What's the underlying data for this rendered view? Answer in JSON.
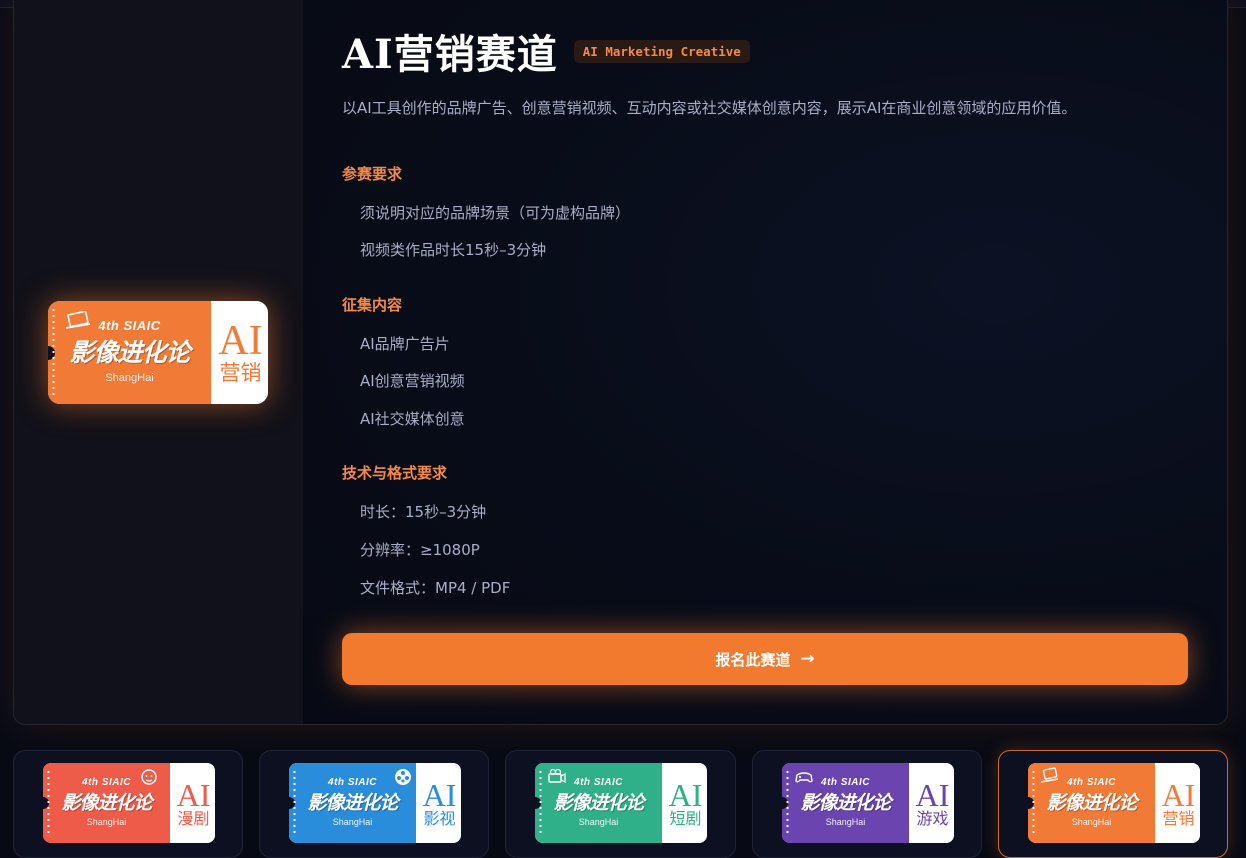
{
  "track": {
    "title": "AI营销赛道",
    "badge": "AI Marketing Creative",
    "description": "以AI工具创作的品牌广告、创意营销视频、互动内容或社交媒体创意内容，展示AI在商业创意领域的应用价值。",
    "sections": [
      {
        "title": "参赛要求",
        "items": [
          "须说明对应的品牌场景（可为虚构品牌）",
          "视频类作品时长15秒–3分钟"
        ]
      },
      {
        "title": "征集内容",
        "items": [
          "AI品牌广告片",
          "AI创意营销视频",
          "AI社交媒体创意"
        ]
      },
      {
        "title": "技术与格式要求",
        "items": [
          "时长：15秒–3分钟",
          "分辨率：≥1080P",
          "文件格式：MP4 / PDF"
        ]
      }
    ],
    "cta_label": "报名此赛道",
    "cta_icon": "→"
  },
  "ticket": {
    "edition": "4th SIAIC",
    "name": "影像进化论",
    "city": "ShangHai",
    "ai": "AI"
  },
  "main_ticket": {
    "category": "营销",
    "color": "#f27a37"
  },
  "cards": [
    {
      "category": "漫剧",
      "color": "#ee5b48",
      "icon": "monkey-icon",
      "active": false
    },
    {
      "category": "影视",
      "color": "#2a8ddc",
      "icon": "film-reel-icon",
      "active": false
    },
    {
      "category": "短剧",
      "color": "#2fb088",
      "icon": "camera-icon",
      "active": false
    },
    {
      "category": "游戏",
      "color": "#6a45b0",
      "icon": "gamepad-icon",
      "active": false
    },
    {
      "category": "营销",
      "color": "#f27a37",
      "icon": "laptop-icon",
      "active": true
    }
  ]
}
